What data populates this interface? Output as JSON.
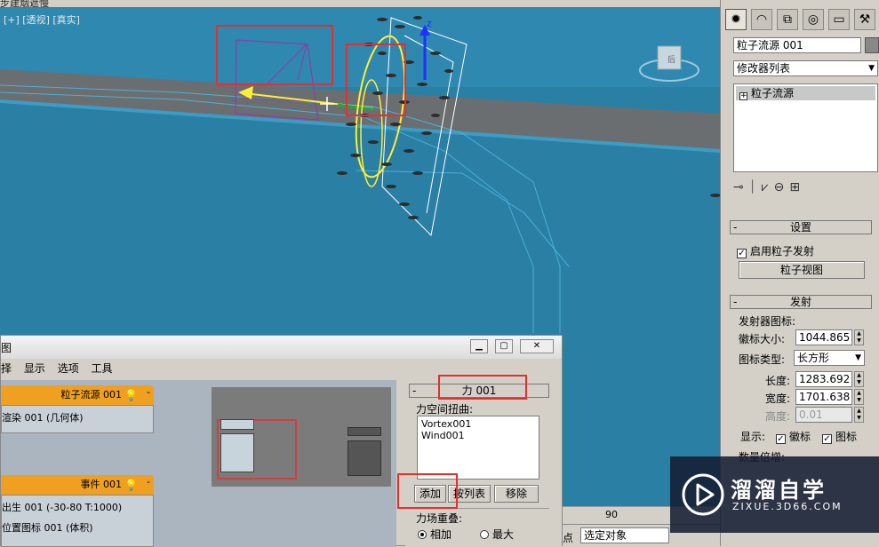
{
  "viewport": {
    "title_fragment": "步建烟遮慢",
    "labels": "[+] [透视] [真实]",
    "axis_z": "z",
    "gizmo_label": "后"
  },
  "command_panel": {
    "tabs": [
      "create-icon",
      "modify-icon",
      "hierarchy-icon",
      "motion-icon",
      "display-icon",
      "utilities-icon"
    ],
    "object_name": "粒子流源 001",
    "modifier_list": "修改器列表",
    "stack_item": "粒子流源",
    "setup": {
      "title": "设置",
      "enable_label": "启用粒子发射",
      "enable_checked": true,
      "particle_view_button": "粒子视图"
    },
    "emission": {
      "title": "发射",
      "group_label": "发射器图标:",
      "logo_size_label": "徽标大小:",
      "logo_size_value": "1044.865",
      "icon_type_label": "图标类型:",
      "icon_type_value": "长方形",
      "length_label": "长度:",
      "length_value": "1283.692",
      "width_label": "宽度:",
      "width_value": "1701.638",
      "height_label": "高度:",
      "height_value": "0.01",
      "show_label": "显示:",
      "show_logo_label": "徽标",
      "show_logo_checked": true,
      "show_icon_label": "图标",
      "show_icon_checked": true,
      "quantity_label": "数量倍增:"
    }
  },
  "particle_view": {
    "title_fragment": "图",
    "menu": [
      "择",
      "显示",
      "选项",
      "工具"
    ],
    "nodes": [
      {
        "header": "粒子流源 001",
        "rows": [
          "渲染 001 (几何体)"
        ]
      },
      {
        "header": "事件 001",
        "rows": [
          "出生 001 (-30-80 T:1000)",
          "位置图标 001 (体积)"
        ]
      }
    ],
    "force_panel": {
      "title": "力 001",
      "group_label": "力空间扭曲:",
      "forces": [
        "Vortex001",
        "Wind001"
      ],
      "add_button": "添加",
      "list_button": "按列表",
      "remove_button": "移除",
      "overlap_label": "力场重叠:",
      "overlap_options": [
        "相加",
        "最大"
      ],
      "overlap_selected": "相加"
    }
  },
  "statusbar": {
    "frame_value": "90",
    "left_char": "点",
    "selection_dropdown": "选定对象"
  },
  "watermark": {
    "brand": "溜溜自学",
    "url": "ZIXUE.3D66.COM"
  },
  "colors": {
    "viewport_bg": "#2a7fa5",
    "node_header": "#f0a020",
    "highlight_box": "#e03030",
    "emitter_yellow": "#ffee33",
    "emitter_purple": "#8a3ea8"
  }
}
